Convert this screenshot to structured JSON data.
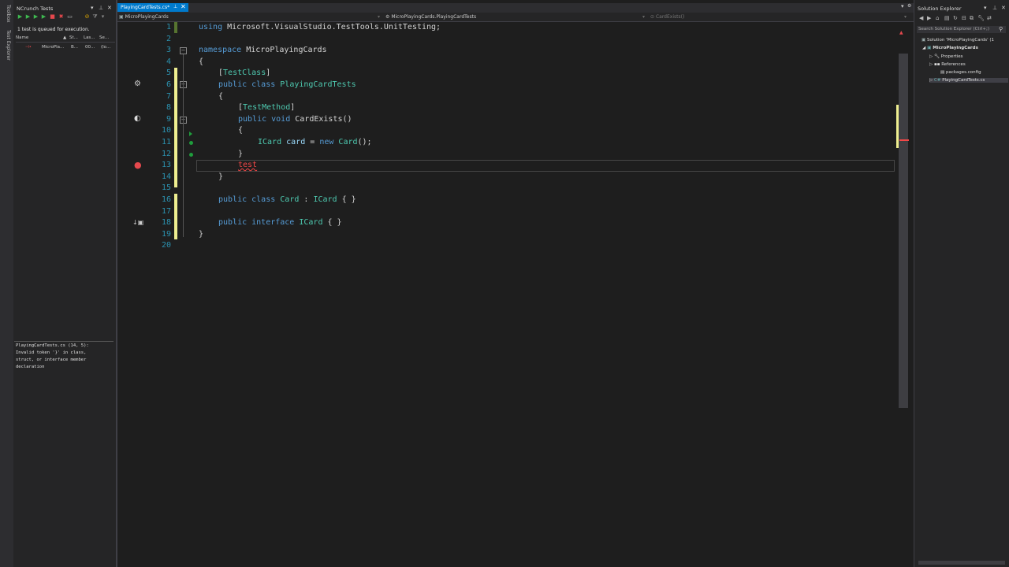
{
  "toolstrip": {
    "tabs": [
      "Toolbox",
      "Test Explorer"
    ]
  },
  "ncrunch": {
    "title": "NCrunch Tests",
    "status": "1 test is queued for execution.",
    "columns": [
      "Name",
      "St...",
      "Las...",
      "Se..."
    ],
    "rows": [
      {
        "name": "MicroPla...",
        "status": "B...",
        "last": "00...",
        "se": "(lo..."
      }
    ],
    "error_text": "PlayingCardTests.cs (14, 5):\nInvalid token '}' in class,\nstruct, or interface member\ndeclaration"
  },
  "editor": {
    "active_tab": "PlayingCardTests.cs*",
    "nav": {
      "project": "MicroPlayingCards",
      "class": "MicroPlayingCards.PlayingCardTests",
      "member": "CardExists()"
    },
    "lines": [
      {
        "n": "1"
      },
      {
        "n": "2"
      },
      {
        "n": "3"
      },
      {
        "n": "4"
      },
      {
        "n": "5"
      },
      {
        "n": "6"
      },
      {
        "n": "7"
      },
      {
        "n": "8"
      },
      {
        "n": "9"
      },
      {
        "n": "10"
      },
      {
        "n": "11"
      },
      {
        "n": "12"
      },
      {
        "n": "13"
      },
      {
        "n": "14"
      },
      {
        "n": "15"
      },
      {
        "n": "16"
      },
      {
        "n": "17"
      },
      {
        "n": "18"
      },
      {
        "n": "19"
      },
      {
        "n": "20"
      }
    ],
    "code": {
      "l1_using": "using",
      "l1_ns": "Microsoft.VisualStudio.TestTools.UnitTesting;",
      "l3_kw": "namespace",
      "l3_name": "MicroPlayingCards",
      "l4": "{",
      "l5_open": "[",
      "l5_attr": "TestClass",
      "l5_close": "]",
      "l6_kw": "public class",
      "l6_name": "PlayingCardTests",
      "l7": "{",
      "l8_open": "[",
      "l8_attr": "TestMethod",
      "l8_close": "]",
      "l9_kw": "public void",
      "l9_name": "CardExists()",
      "l10": "{",
      "l11_type": "ICard",
      "l11_var": "card",
      "l11_eq": "=",
      "l11_new": "new",
      "l11_ctor": "Card",
      "l11_end": "();",
      "l12": "}",
      "l13": "test",
      "l14": "}",
      "l16_kw": "public class",
      "l16_name": "Card",
      "l16_colon": ":",
      "l16_iface": "ICard",
      "l16_body": "{ }",
      "l18_kw": "public interface",
      "l18_name": "ICard",
      "l18_body": "{ }",
      "l19": "}"
    }
  },
  "solution_explorer": {
    "title": "Solution Explorer",
    "search_placeholder": "Search Solution Explorer (Ctrl+;)",
    "items": [
      "Solution 'MicroPlayingCards' (1",
      "MicroPlayingCards",
      "Properties",
      "References",
      "packages.config",
      "PlayingCardTests.cs"
    ]
  },
  "colors": {
    "accent": "#007acc",
    "keyword": "#569cd6",
    "type": "#4ec9b0",
    "error": "#f44747",
    "line_number": "#2b91af",
    "modified": "#efef90",
    "saved": "#577430"
  }
}
